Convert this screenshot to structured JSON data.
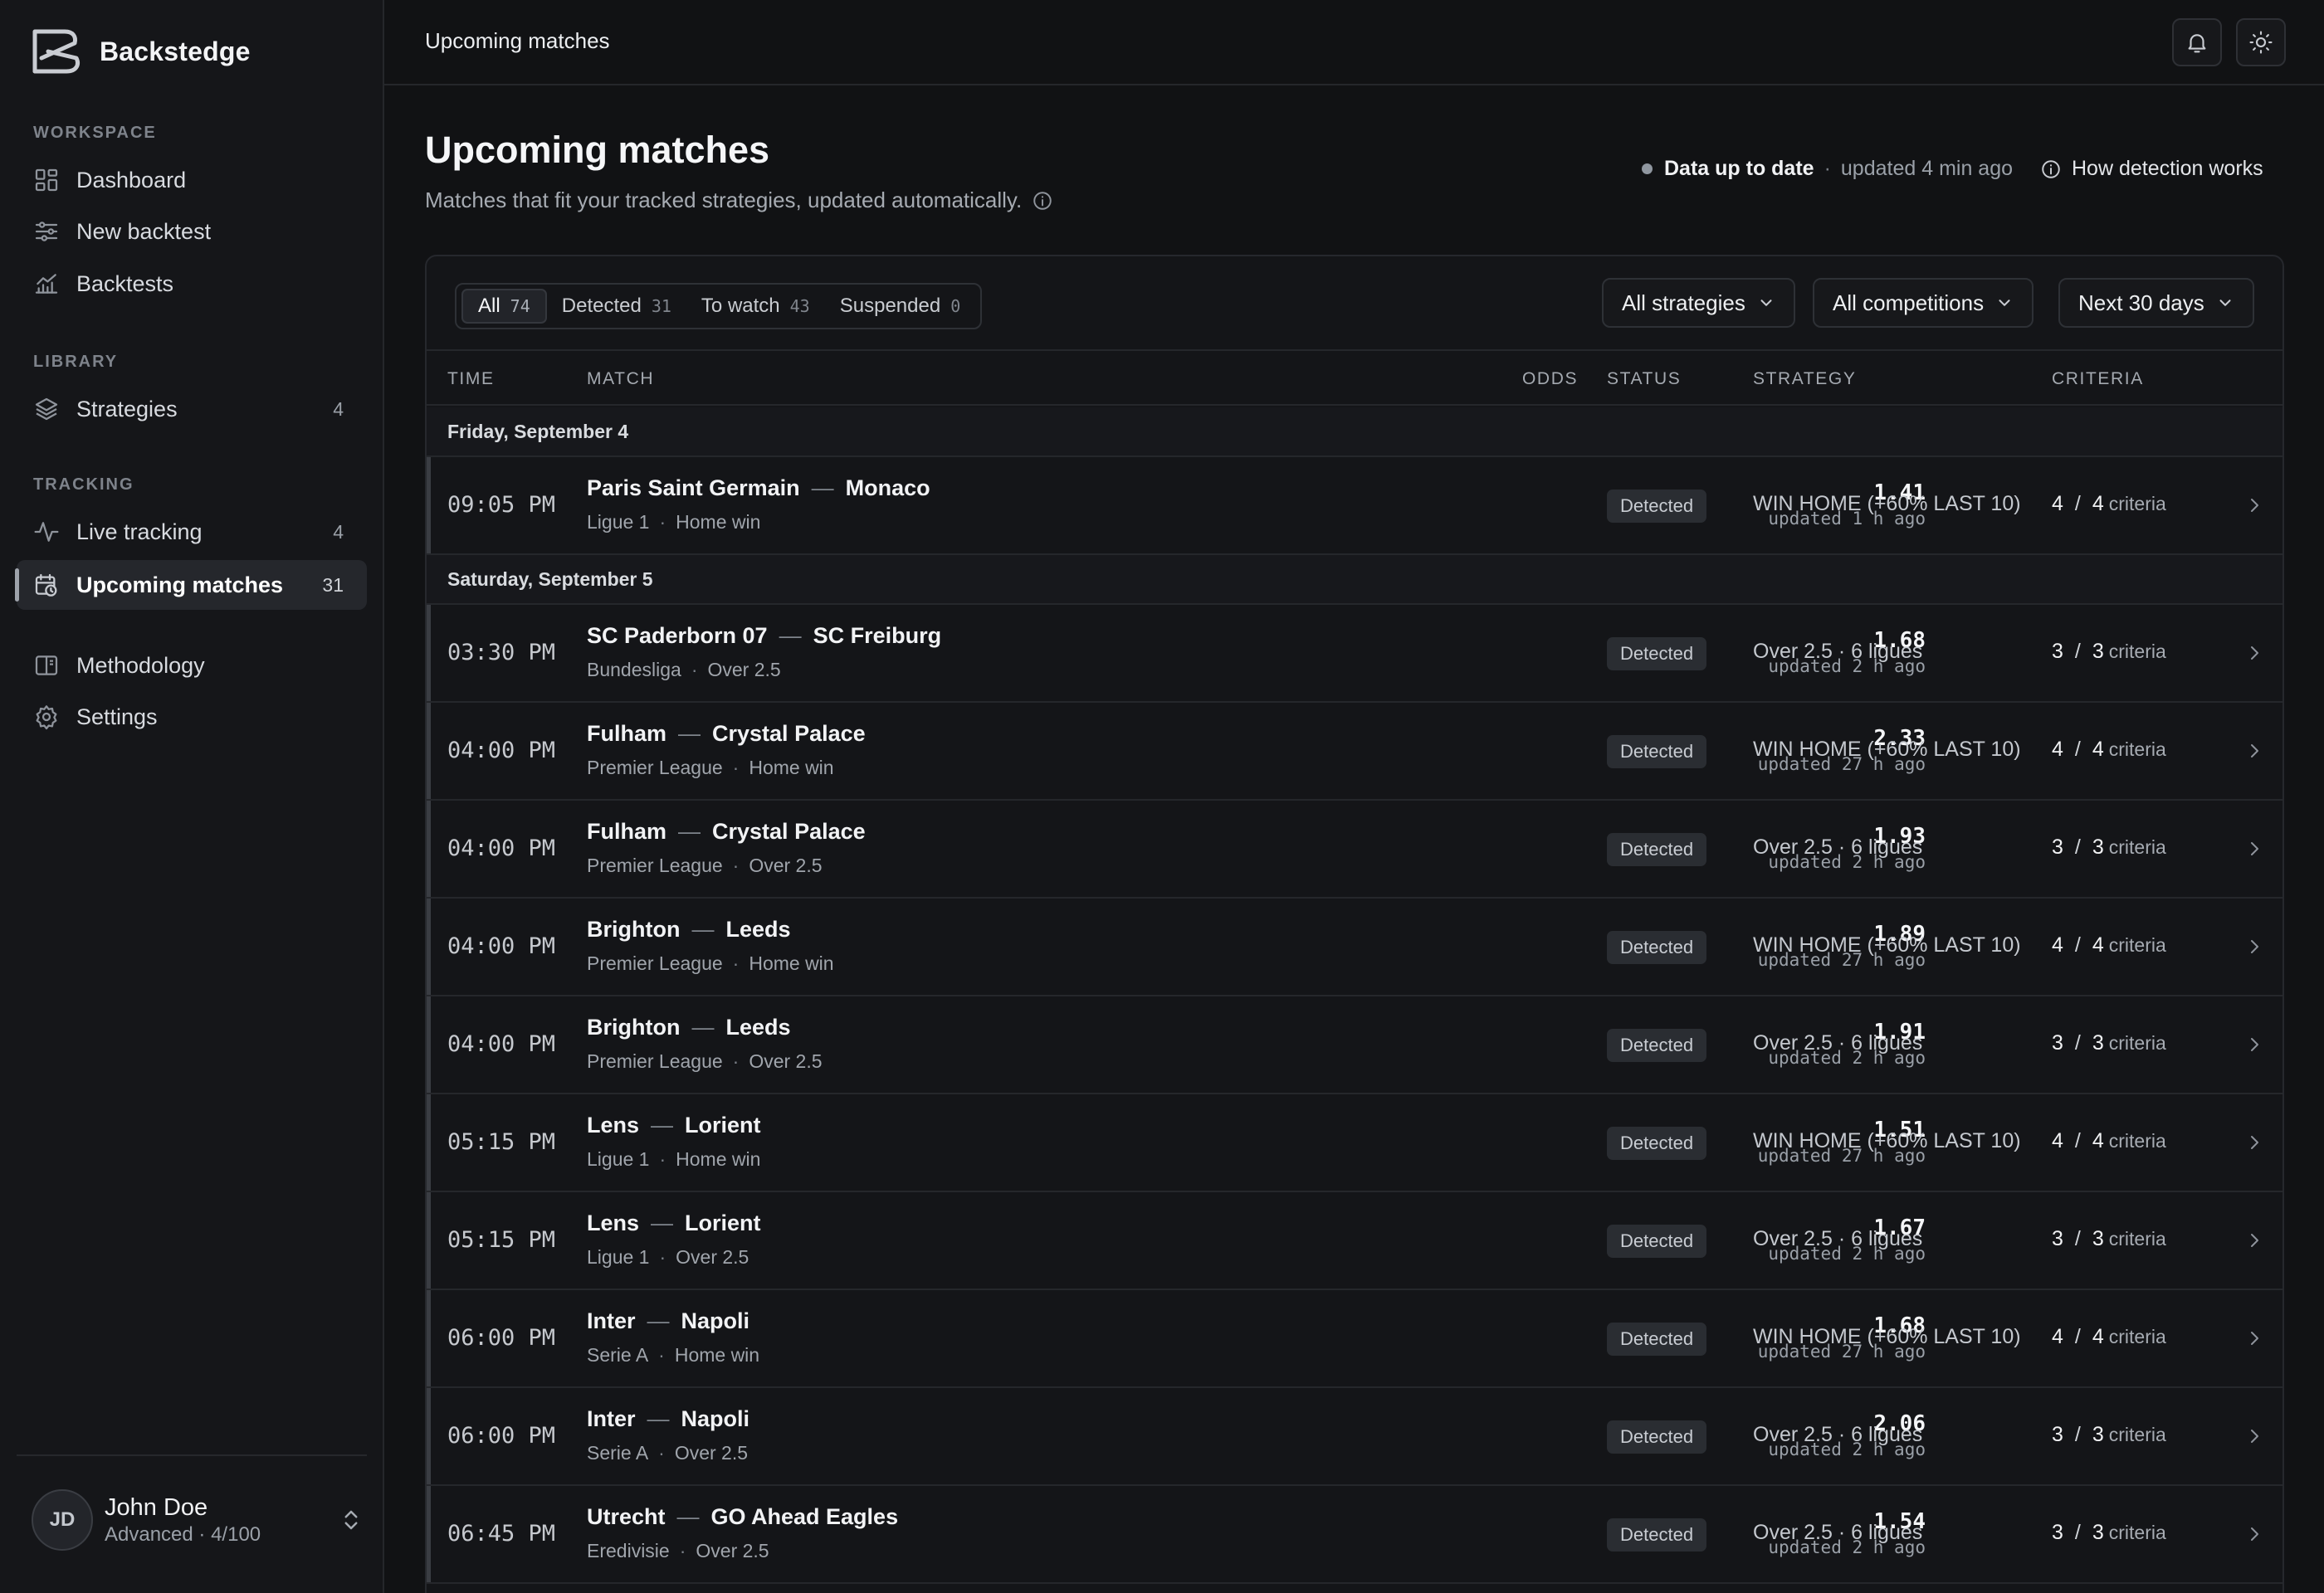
{
  "app": {
    "name": "Backstedge"
  },
  "sidebar": {
    "sections": {
      "workspace": "Workspace",
      "library": "Library",
      "tracking": "Tracking"
    },
    "items": {
      "dashboard": {
        "label": "Dashboard"
      },
      "new_backtest": {
        "label": "New backtest"
      },
      "backtests": {
        "label": "Backtests"
      },
      "strategies": {
        "label": "Strategies",
        "count": "4"
      },
      "live_tracking": {
        "label": "Live tracking",
        "count": "4"
      },
      "upcoming_matches": {
        "label": "Upcoming matches",
        "count": "31"
      },
      "methodology": {
        "label": "Methodology"
      },
      "settings": {
        "label": "Settings"
      }
    },
    "user": {
      "initials": "JD",
      "name": "John Doe",
      "plan": "Advanced · 4/100"
    }
  },
  "topbar": {
    "title": "Upcoming matches"
  },
  "header": {
    "title": "Upcoming matches",
    "subtitle": "Matches that fit your tracked strategies, updated automatically.",
    "status_label": "Data up to date",
    "status_sep": "·",
    "status_updated": "updated 4 min ago",
    "how_link": "How detection works"
  },
  "filters": {
    "tabs": [
      {
        "label": "All",
        "count": "74"
      },
      {
        "label": "Detected",
        "count": "31"
      },
      {
        "label": "To watch",
        "count": "43"
      },
      {
        "label": "Suspended",
        "count": "0"
      }
    ],
    "strategy_select": "All strategies",
    "competition_select": "All competitions",
    "period_select": "Next 30 days"
  },
  "table": {
    "headers": {
      "time": "Time",
      "match": "Match",
      "odds": "Odds",
      "status": "Status",
      "strategy": "Strategy",
      "criteria": "Criteria"
    },
    "groups": [
      {
        "date": "Friday, September 4"
      },
      {
        "date": "Saturday, September 5"
      }
    ],
    "criteria_word": "criteria",
    "rows": [
      {
        "time": "09:05 PM",
        "home": "Paris Saint Germain",
        "away": "Monaco",
        "competition": "Ligue 1",
        "market": "Home win",
        "odds": "1.41",
        "odds_updated": "updated 1 h ago",
        "status": "Detected",
        "strategy": "WIN HOME (+60% LAST 10)",
        "met": "4",
        "total": "4"
      },
      {
        "time": "03:30 PM",
        "home": "SC Paderborn 07",
        "away": "SC Freiburg",
        "competition": "Bundesliga",
        "market": "Over 2.5",
        "odds": "1.68",
        "odds_updated": "updated 2 h ago",
        "status": "Detected",
        "strategy": "Over 2.5 · 6 ligues",
        "met": "3",
        "total": "3"
      },
      {
        "time": "04:00 PM",
        "home": "Fulham",
        "away": "Crystal Palace",
        "competition": "Premier League",
        "market": "Home win",
        "odds": "2.33",
        "odds_updated": "updated 27 h ago",
        "status": "Detected",
        "strategy": "WIN HOME (+60% LAST 10)",
        "met": "4",
        "total": "4"
      },
      {
        "time": "04:00 PM",
        "home": "Fulham",
        "away": "Crystal Palace",
        "competition": "Premier League",
        "market": "Over 2.5",
        "odds": "1.93",
        "odds_updated": "updated 2 h ago",
        "status": "Detected",
        "strategy": "Over 2.5 · 6 ligues",
        "met": "3",
        "total": "3"
      },
      {
        "time": "04:00 PM",
        "home": "Brighton",
        "away": "Leeds",
        "competition": "Premier League",
        "market": "Home win",
        "odds": "1.89",
        "odds_updated": "updated 27 h ago",
        "status": "Detected",
        "strategy": "WIN HOME (+60% LAST 10)",
        "met": "4",
        "total": "4"
      },
      {
        "time": "04:00 PM",
        "home": "Brighton",
        "away": "Leeds",
        "competition": "Premier League",
        "market": "Over 2.5",
        "odds": "1.91",
        "odds_updated": "updated 2 h ago",
        "status": "Detected",
        "strategy": "Over 2.5 · 6 ligues",
        "met": "3",
        "total": "3"
      },
      {
        "time": "05:15 PM",
        "home": "Lens",
        "away": "Lorient",
        "competition": "Ligue 1",
        "market": "Home win",
        "odds": "1.51",
        "odds_updated": "updated 27 h ago",
        "status": "Detected",
        "strategy": "WIN HOME (+60% LAST 10)",
        "met": "4",
        "total": "4"
      },
      {
        "time": "05:15 PM",
        "home": "Lens",
        "away": "Lorient",
        "competition": "Ligue 1",
        "market": "Over 2.5",
        "odds": "1.67",
        "odds_updated": "updated 2 h ago",
        "status": "Detected",
        "strategy": "Over 2.5 · 6 ligues",
        "met": "3",
        "total": "3"
      },
      {
        "time": "06:00 PM",
        "home": "Inter",
        "away": "Napoli",
        "competition": "Serie A",
        "market": "Home win",
        "odds": "1.68",
        "odds_updated": "updated 27 h ago",
        "status": "Detected",
        "strategy": "WIN HOME (+60% LAST 10)",
        "met": "4",
        "total": "4"
      },
      {
        "time": "06:00 PM",
        "home": "Inter",
        "away": "Napoli",
        "competition": "Serie A",
        "market": "Over 2.5",
        "odds": "2.06",
        "odds_updated": "updated 2 h ago",
        "status": "Detected",
        "strategy": "Over 2.5 · 6 ligues",
        "met": "3",
        "total": "3"
      },
      {
        "time": "06:45 PM",
        "home": "Utrecht",
        "away": "GO Ahead Eagles",
        "competition": "Eredivisie",
        "market": "Over 2.5",
        "odds": "1.54",
        "odds_updated": "updated 2 h ago",
        "status": "Detected",
        "strategy": "Over 2.5 · 6 ligues",
        "met": "3",
        "total": "3"
      }
    ]
  }
}
